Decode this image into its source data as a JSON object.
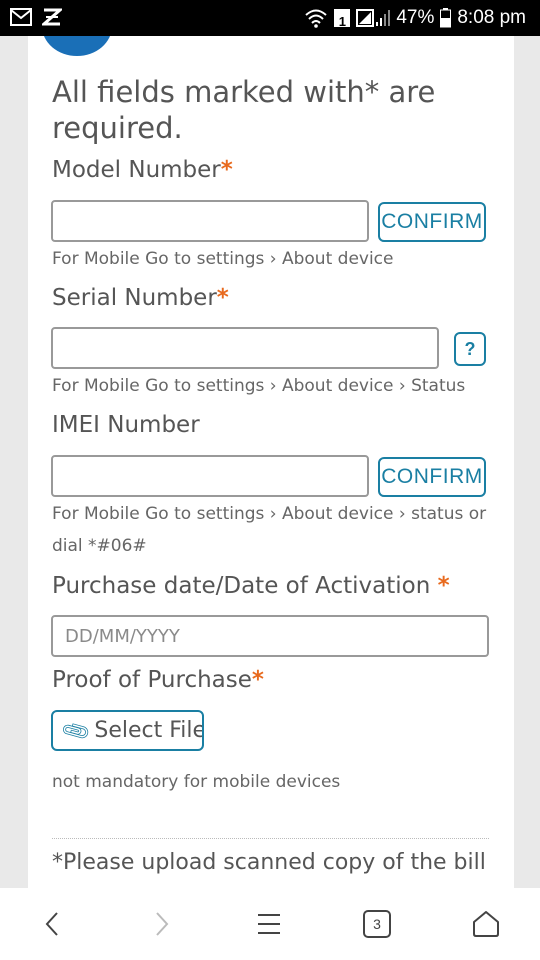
{
  "status_bar": {
    "sim_badge": "1",
    "battery": "47%",
    "time": "8:08 pm"
  },
  "form": {
    "required_note": "All fields marked with* are required.",
    "model": {
      "label": "Model Number",
      "required_mark": "*",
      "value": "",
      "confirm_label": "CONFIRM",
      "hint": "For Mobile Go to settings › About device"
    },
    "serial": {
      "label": "Serial Number",
      "required_mark": "*",
      "value": "",
      "help_label": "?",
      "hint": "For Mobile Go to settings › About device › Status"
    },
    "imei": {
      "label": "IMEI Number",
      "value": "",
      "confirm_label": "CONFIRM",
      "hint": "For Mobile Go to settings › About device › status or dial *#06#"
    },
    "purchase_date": {
      "label": "Purchase date/Date of Activation ",
      "required_mark": "*",
      "placeholder": "DD/MM/YYYY"
    },
    "proof": {
      "label": "Proof of Purchase",
      "required_mark": "*",
      "button_label": "Select File",
      "hint": "not mandatory for mobile devices"
    },
    "bill_note": "*Please upload scanned copy of the bill"
  },
  "bottom_nav": {
    "tab_count": "3"
  }
}
